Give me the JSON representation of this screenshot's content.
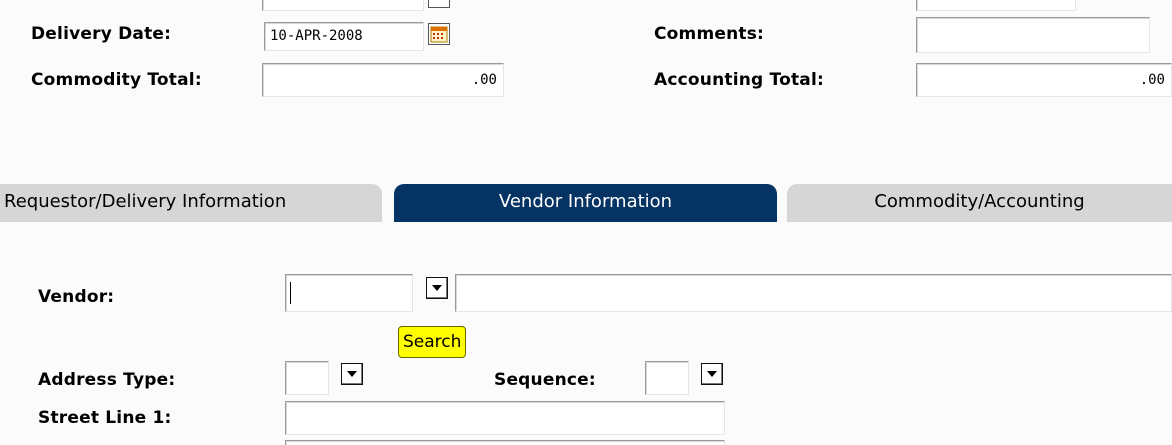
{
  "header": {
    "delivery_date_label": "Delivery Date:",
    "delivery_date_value": "10-APR-2008",
    "comments_label": "Comments:",
    "comments_value": "",
    "commodity_total_label": "Commodity Total:",
    "commodity_total_value": ".00",
    "accounting_total_label": "Accounting Total:",
    "accounting_total_value": ".00"
  },
  "tabs": [
    {
      "label": "Requestor/Delivery Information",
      "active": false
    },
    {
      "label": "Vendor Information",
      "active": true
    },
    {
      "label": "Commodity/Accounting",
      "active": false
    }
  ],
  "vendor_form": {
    "vendor_label": "Vendor:",
    "vendor_id_value": "",
    "vendor_name_value": "",
    "search_button_label": "Search",
    "address_type_label": "Address Type:",
    "address_type_value": "",
    "sequence_label": "Sequence:",
    "sequence_value": "",
    "street_line_1_label": "Street Line 1:",
    "street_line_1_value": ""
  },
  "icons": {
    "calendar": "calendar-icon",
    "dropdown": "chevron-down-icon"
  },
  "colors": {
    "active_tab_bg": "#053363",
    "inactive_tab_bg": "#d6d6d6",
    "search_button_bg": "#ffff00"
  }
}
